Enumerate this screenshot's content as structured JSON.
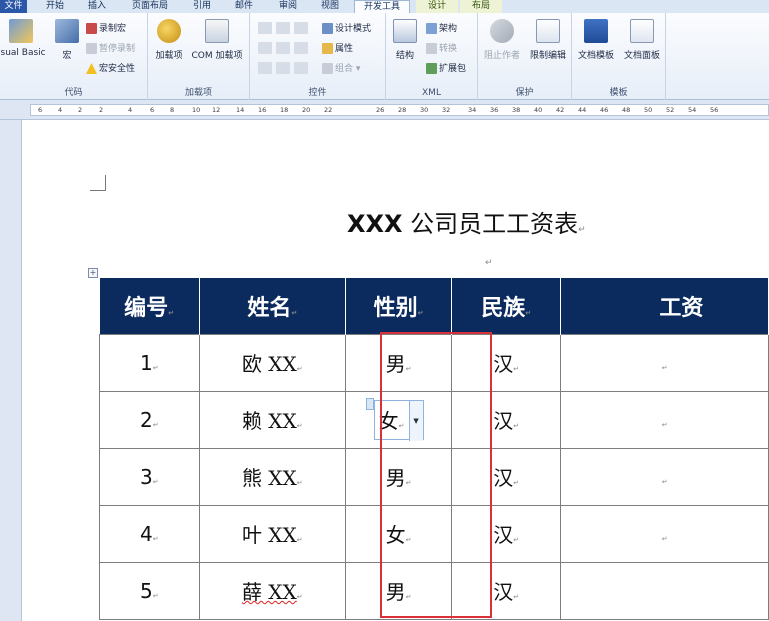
{
  "ribbon": {
    "tabs": [
      {
        "label": "文件",
        "kind": "file"
      },
      {
        "label": "开始",
        "kind": ""
      },
      {
        "label": "插入",
        "kind": ""
      },
      {
        "label": "页面布局",
        "kind": ""
      },
      {
        "label": "引用",
        "kind": ""
      },
      {
        "label": "邮件",
        "kind": ""
      },
      {
        "label": "审阅",
        "kind": ""
      },
      {
        "label": "视图",
        "kind": ""
      },
      {
        "label": "开发工具",
        "kind": "active"
      },
      {
        "label": "设计",
        "kind": "ctx"
      },
      {
        "label": "布局",
        "kind": "ctx"
      }
    ],
    "groups": {
      "code": {
        "label": "代码",
        "visual_basic": "isual Basic",
        "macros": "宏",
        "record_macro": "录制宏",
        "pause_recording": "暂停录制",
        "macro_security": "宏安全性"
      },
      "addins": {
        "label": "加载项",
        "addins": "加载项",
        "com_addins": "COM 加载项"
      },
      "controls": {
        "label": "控件",
        "design_mode": "设计模式",
        "properties": "属性",
        "group": "组合"
      },
      "xml": {
        "label": "XML",
        "structure": "结构",
        "schema": "架构",
        "transform": "转换",
        "expansion_pack": "扩展包"
      },
      "protect": {
        "label": "保护",
        "block_authors": "阻止作者",
        "restrict_editing": "限制编辑"
      },
      "templates": {
        "label": "模板",
        "document_template": "文档模板",
        "document_panel": "文档面板"
      }
    }
  },
  "ruler": {
    "ticks": [
      "6",
      "4",
      "2",
      "2",
      "4",
      "6",
      "8",
      "10",
      "12",
      "14",
      "16",
      "18",
      "20",
      "22",
      "26",
      "28",
      "30",
      "32",
      "34",
      "36",
      "38",
      "40",
      "42",
      "44",
      "46",
      "48",
      "50",
      "52",
      "54",
      "56"
    ]
  },
  "document": {
    "title_latin": "XXX",
    "title_cn": " 公司员工工资表",
    "paragraph_mark": "↵",
    "table_handle_glyph": "+",
    "table": {
      "headers": [
        "编号",
        "姓名",
        "性别",
        "民族",
        "工资"
      ],
      "rows": [
        {
          "num": "1",
          "name": "欧 XX",
          "gender": "男",
          "ethnicity": "汉",
          "salary": ""
        },
        {
          "num": "2",
          "name": "赖 XX",
          "gender": "女",
          "ethnicity": "汉",
          "salary": ""
        },
        {
          "num": "3",
          "name": "熊 XX",
          "gender": "男",
          "ethnicity": "汉",
          "salary": ""
        },
        {
          "num": "4",
          "name": "叶 XX",
          "gender": "女",
          "ethnicity": "汉",
          "salary": ""
        },
        {
          "num": "5",
          "name": "薛 XX",
          "gender": "男",
          "ethnicity": "汉",
          "salary": ""
        }
      ]
    }
  },
  "colors": {
    "header_bg": "#0b2a5e",
    "highlight_border": "#d9303a",
    "ribbon_bg": "#e7eef8",
    "file_tab": "#2b57a8"
  }
}
